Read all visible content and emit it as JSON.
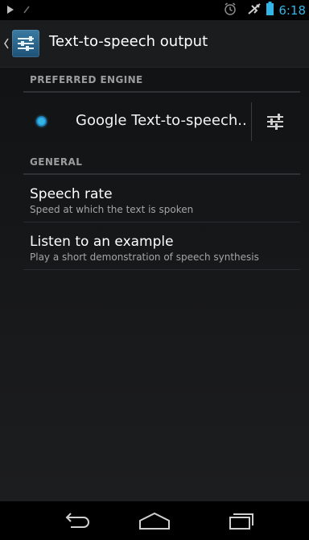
{
  "status_bar": {
    "left_icons": [
      "play-icon",
      "signal-icon"
    ],
    "right_icons": [
      "alarm-icon",
      "airplane-mode-icon",
      "battery-icon"
    ],
    "time": "6:18",
    "accent": "#33b5e5"
  },
  "action_bar": {
    "title": "Text-to-speech output",
    "up_icon": "up-caret-icon",
    "app_icon": "settings-sliders-icon"
  },
  "sections": {
    "preferred_engine": {
      "header": "PREFERRED ENGINE",
      "engine": {
        "name": "Google Text-to-speech..",
        "selected": true,
        "settings_icon": "engine-settings-icon"
      }
    },
    "general": {
      "header": "GENERAL",
      "items": [
        {
          "title": "Speech rate",
          "summary": "Speed at which the text is spoken"
        },
        {
          "title": "Listen to an example",
          "summary": "Play a short demonstration of speech synthesis"
        }
      ]
    }
  },
  "nav_bar": {
    "buttons": [
      "back-icon",
      "home-icon",
      "recents-icon"
    ]
  }
}
